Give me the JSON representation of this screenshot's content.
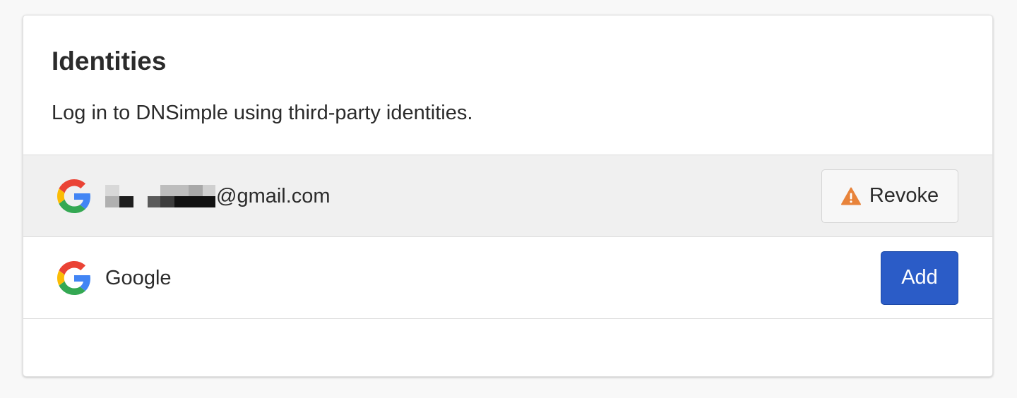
{
  "section": {
    "title": "Identities",
    "description": "Log in to DNSimple using third-party identities."
  },
  "identities": [
    {
      "provider_icon": "google-icon",
      "label": "@gmail.com",
      "label_redacted": true,
      "action": {
        "label": "Revoke",
        "icon": "warning-icon"
      },
      "connected": true
    },
    {
      "provider_icon": "google-icon",
      "label": "Google",
      "label_redacted": false,
      "action": {
        "label": "Add"
      },
      "connected": false
    }
  ],
  "colors": {
    "add_button": "#2b5cc7",
    "warning": "#e8833a",
    "connected_row_bg": "#f0f0f0"
  }
}
